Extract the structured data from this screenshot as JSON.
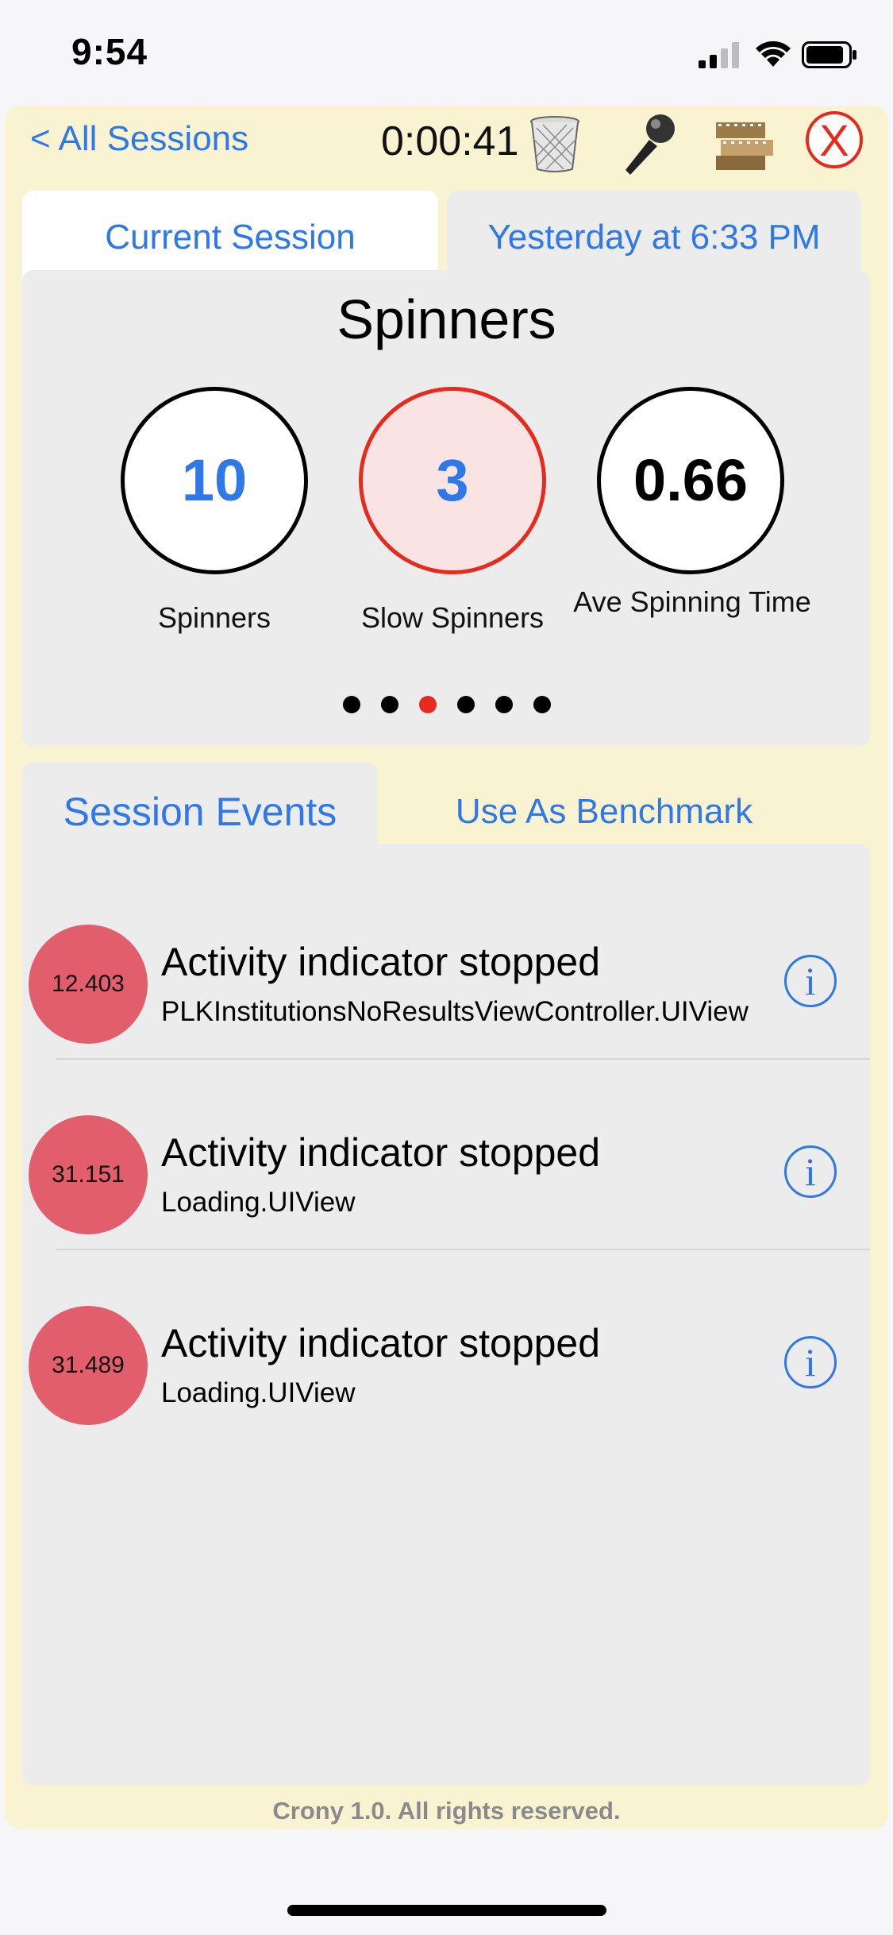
{
  "status_bar": {
    "time": "9:54"
  },
  "toolbar": {
    "back_label": "< All Sessions",
    "timer": "0:00:41",
    "close_label": "X"
  },
  "tabs": {
    "current": "Current Session",
    "yesterday": "Yesterday at 6:33 PM"
  },
  "panel": {
    "title": "Spinners",
    "stats": [
      {
        "value": "10",
        "label": "Spinners"
      },
      {
        "value": "3",
        "label": "Slow Spinners"
      },
      {
        "value": "0.66",
        "label": "Ave Spinning Time"
      }
    ],
    "pager": {
      "count": 6,
      "active_index": 2
    }
  },
  "events_tabs": {
    "events": "Session Events",
    "benchmark": "Use As Benchmark"
  },
  "events": [
    {
      "time": "12.403",
      "title": "Activity indicator stopped",
      "subtitle": "PLKInstitutionsNoResultsViewController.UIView"
    },
    {
      "time": "31.151",
      "title": "Activity indicator stopped",
      "subtitle": "Loading.UIView"
    },
    {
      "time": "31.489",
      "title": "Activity indicator stopped",
      "subtitle": "Loading.UIView"
    }
  ],
  "footer": "Crony 1.0. All rights reserved.",
  "colors": {
    "accent": "#2f78e8",
    "warning": "#e52a1e",
    "badge": "#e25e6c",
    "app_background": "#faf3d2",
    "panel": "#ececec"
  },
  "icons": {
    "trash": "trash-icon",
    "microphone": "microphone-icon",
    "film": "film-icon",
    "close": "close-icon",
    "info": "info-icon"
  }
}
